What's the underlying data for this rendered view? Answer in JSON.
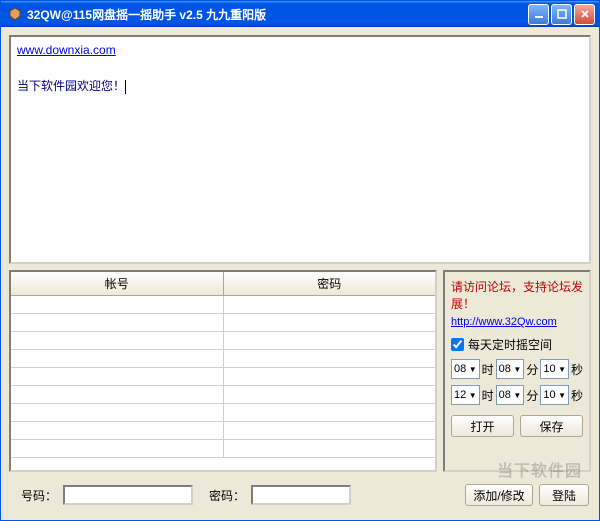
{
  "titlebar": {
    "text": "32QW@115网盘摇一摇助手  v2.5 九九重阳版"
  },
  "richedit": {
    "link_text": "www.downxia.com",
    "message": "当下软件园欢迎您！"
  },
  "grid": {
    "headers": {
      "account": "帐号",
      "password": "密码"
    },
    "rows": []
  },
  "side": {
    "forum_msg": "请访问论坛，支持论坛发展！",
    "forum_link": "http://www.32Qw.com",
    "daily_check_label": "每天定时摇空间",
    "daily_checked": true,
    "time1": {
      "hour": "08",
      "min": "08",
      "sec": "10"
    },
    "time2": {
      "hour": "12",
      "min": "08",
      "sec": "10"
    },
    "labels": {
      "hour": "时",
      "min": "分",
      "sec": "秒"
    },
    "btn_open": "打开",
    "btn_save": "保存"
  },
  "bottom": {
    "label_number": "号码：",
    "label_password": "密码：",
    "number_value": "",
    "password_value": "",
    "btn_addmod": "添加/修改",
    "btn_login": "登陆"
  },
  "watermark": "当下软件园"
}
